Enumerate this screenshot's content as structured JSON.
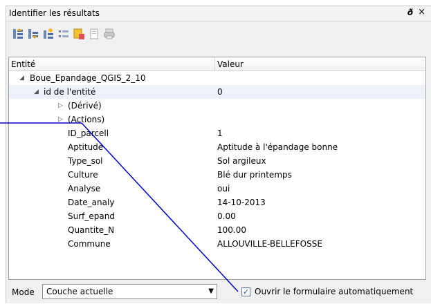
{
  "window": {
    "title": "Identifier les résultats",
    "float_glyph": "ð",
    "close_glyph": "×"
  },
  "toolbar": {
    "icons": [
      "expand-all-icon",
      "collapse-all-icon",
      "expand-new-icon",
      "clear-results-icon",
      "copy-feature-icon",
      "copy-results-icon",
      "print-icon"
    ]
  },
  "tree": {
    "headers": {
      "field": "Entité",
      "value": "Valeur"
    },
    "layer": "Boue_Epandage_QGIS_2_10",
    "feature": {
      "label": "id de l'entité",
      "value": "0"
    },
    "derived": "(Dérivé)",
    "actions": "(Actions)",
    "attributes": [
      {
        "field": "ID_parcell",
        "value": "1"
      },
      {
        "field": "Aptitude",
        "value": "Aptitude à l'épandage bonne"
      },
      {
        "field": "Type_sol",
        "value": "Sol argileux"
      },
      {
        "field": "Culture",
        "value": "Blé dur printemps"
      },
      {
        "field": "Analyse",
        "value": "oui"
      },
      {
        "field": "Date_analy",
        "value": "14-10-2013"
      },
      {
        "field": "Surf_epand",
        "value": "0.00"
      },
      {
        "field": "Quantite_N",
        "value": "100.00"
      },
      {
        "field": "Commune",
        "value": "ALLOUVILLE-BELLEFOSSE"
      }
    ]
  },
  "bottom": {
    "mode_label": "Mode",
    "mode_value": "Couche actuelle",
    "auto_open_label": "Ouvrir le formulaire automatiquement",
    "auto_open_checked": true
  },
  "colors": {
    "pointer": "#0000cc",
    "selection": "#eef3fb"
  }
}
